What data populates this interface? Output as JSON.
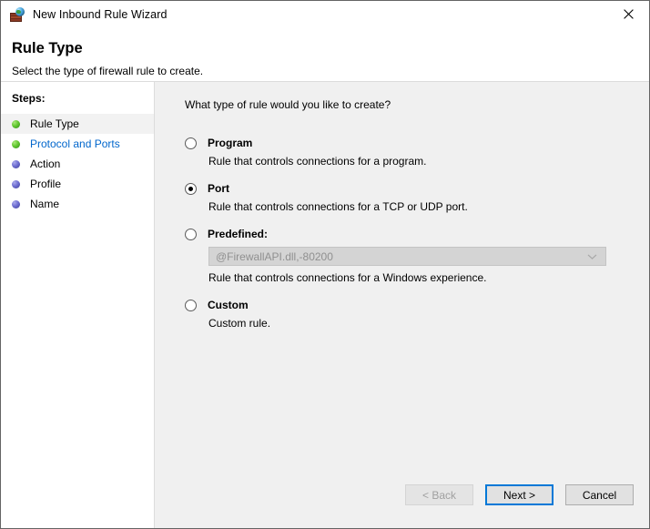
{
  "window": {
    "title": "New Inbound Rule Wizard",
    "icon": "firewall-icon",
    "close_label": "✕"
  },
  "header": {
    "title": "Rule Type",
    "subtitle": "Select the type of firewall rule to create."
  },
  "sidebar": {
    "heading": "Steps:",
    "items": [
      {
        "label": "Rule Type",
        "bullet": "green",
        "state": "current"
      },
      {
        "label": "Protocol and Ports",
        "bullet": "green",
        "state": "link"
      },
      {
        "label": "Action",
        "bullet": "blue",
        "state": "pending"
      },
      {
        "label": "Profile",
        "bullet": "blue",
        "state": "pending"
      },
      {
        "label": "Name",
        "bullet": "blue",
        "state": "pending"
      }
    ]
  },
  "main": {
    "question": "What type of rule would you like to create?",
    "options": [
      {
        "label": "Program",
        "description": "Rule that controls connections for a program.",
        "selected": false
      },
      {
        "label": "Port",
        "description": "Rule that controls connections for a TCP or UDP port.",
        "selected": true
      },
      {
        "label": "Predefined:",
        "description": "Rule that controls connections for a Windows experience.",
        "selected": false,
        "combo_value": "@FirewallAPI.dll,-80200",
        "combo_disabled": true
      },
      {
        "label": "Custom",
        "description": "Custom rule.",
        "selected": false
      }
    ]
  },
  "footer": {
    "back_label": "< Back",
    "next_label": "Next >",
    "cancel_label": "Cancel"
  },
  "colors": {
    "accent": "#0078d7",
    "link": "#0066cc",
    "panel_bg": "#f0f0f0",
    "bullet_done": "#64c832",
    "bullet_pending": "#6f6fd2"
  }
}
